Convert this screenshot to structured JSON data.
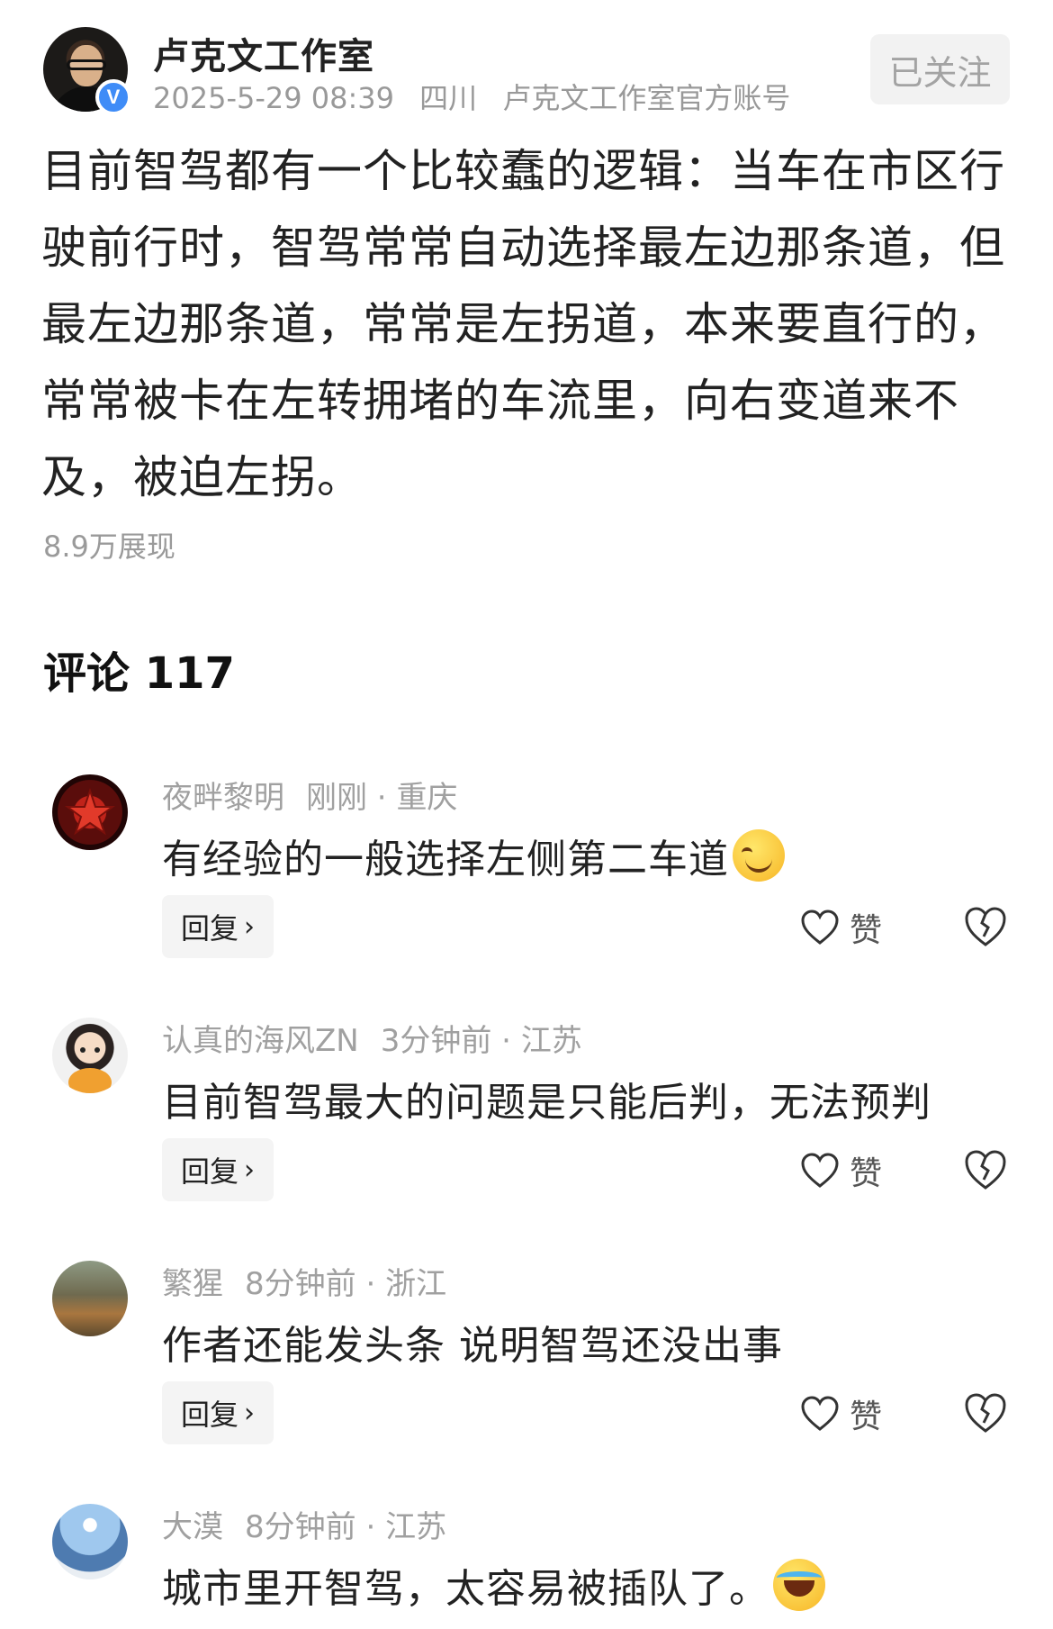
{
  "post": {
    "author_name": "卢克文工作室",
    "verified_badge": "V",
    "date": "2025-5-29 08:39",
    "location": "四川",
    "account_label": "卢克文工作室官方账号",
    "follow_label": "已关注",
    "body": "目前智驾都有一个比较蠢的逻辑：当车在市区行驶前行时，智驾常常自动选择最左边那条道，但最左边那条道，常常是左拐道，本来要直行的，常常被卡在左转拥堵的车流里，向右变道来不及，被迫左拐。",
    "impressions": "8.9万展现"
  },
  "comments_section": {
    "title": "评论 117",
    "reply_label": "回复",
    "like_label": "赞",
    "items": [
      {
        "name": "夜畔黎明",
        "time": "刚刚",
        "location": "重庆",
        "text": "有经验的一般选择左侧第二车道",
        "emoji": "smile-emoji"
      },
      {
        "name": "认真的海风ZN",
        "time": "3分钟前",
        "location": "江苏",
        "text": "目前智驾最大的问题是只能后判，无法预判",
        "emoji": ""
      },
      {
        "name": "繁猩",
        "time": "8分钟前",
        "location": "浙江",
        "text": "作者还能发头条 说明智驾还没出事",
        "emoji": ""
      },
      {
        "name": "大漠",
        "time": "8分钟前",
        "location": "江苏",
        "text": "城市里开智驾，太容易被插队了。",
        "emoji": "crying-laughing-emoji"
      }
    ]
  },
  "colors": {
    "verified": "#3f8cf7",
    "muted_text": "#999999",
    "button_bg": "#f4f4f4"
  }
}
